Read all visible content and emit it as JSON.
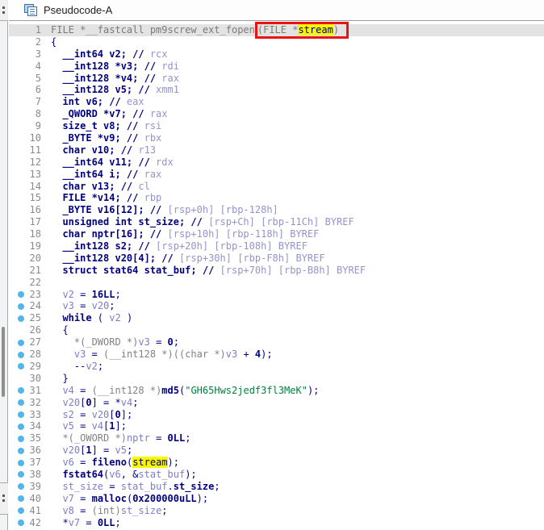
{
  "window": {
    "tab_label": "Pseudocode-A"
  },
  "annotation": {
    "box_color": "#ec1212",
    "highlight_color": "#f7f700",
    "highlighted_identifier": "stream"
  },
  "code": {
    "lines": [
      {
        "n": 1,
        "hl": true,
        "s": [
          [
            "g",
            "FILE *__fastcall pm9screw_ext_fopen"
          ]
        ],
        "box": [
          [
            "g",
            "(FILE *"
          ],
          [
            "y",
            "stream"
          ],
          [
            "g",
            ")"
          ]
        ]
      },
      {
        "n": 2,
        "s": [
          [
            "p",
            "{"
          ]
        ]
      },
      {
        "n": 3,
        "s": [
          [
            "k",
            "  __int64 v2; // "
          ],
          [
            "r",
            "rcx"
          ]
        ]
      },
      {
        "n": 4,
        "s": [
          [
            "k",
            "  __int128 *v3; // "
          ],
          [
            "r",
            "rdi"
          ]
        ]
      },
      {
        "n": 5,
        "s": [
          [
            "k",
            "  __int128 *v4; // "
          ],
          [
            "r",
            "rax"
          ]
        ]
      },
      {
        "n": 6,
        "s": [
          [
            "k",
            "  __int128 v5; // "
          ],
          [
            "r",
            "xmm1"
          ]
        ]
      },
      {
        "n": 7,
        "s": [
          [
            "k",
            "  int v6; // "
          ],
          [
            "r",
            "eax"
          ]
        ]
      },
      {
        "n": 8,
        "s": [
          [
            "k",
            "  _QWORD *v7; // "
          ],
          [
            "r",
            "rax"
          ]
        ]
      },
      {
        "n": 9,
        "s": [
          [
            "k",
            "  size_t v8; // "
          ],
          [
            "r",
            "rsi"
          ]
        ]
      },
      {
        "n": 10,
        "s": [
          [
            "k",
            "  _BYTE *v9; // "
          ],
          [
            "r",
            "rbx"
          ]
        ]
      },
      {
        "n": 11,
        "s": [
          [
            "k",
            "  char v10; // "
          ],
          [
            "r",
            "r13"
          ]
        ]
      },
      {
        "n": 12,
        "s": [
          [
            "k",
            "  __int64 v11; // "
          ],
          [
            "r",
            "rdx"
          ]
        ]
      },
      {
        "n": 13,
        "s": [
          [
            "k",
            "  __int64 i; // "
          ],
          [
            "r",
            "rax"
          ]
        ]
      },
      {
        "n": 14,
        "s": [
          [
            "k",
            "  char v13; // "
          ],
          [
            "r",
            "cl"
          ]
        ]
      },
      {
        "n": 15,
        "s": [
          [
            "k",
            "  FILE *v14; // "
          ],
          [
            "r",
            "rbp"
          ]
        ]
      },
      {
        "n": 16,
        "s": [
          [
            "k",
            "  _BYTE v16[12]; // "
          ],
          [
            "r",
            "[rsp+0h] [rbp-128h]"
          ]
        ]
      },
      {
        "n": 17,
        "s": [
          [
            "k",
            "  unsigned int st_size; // "
          ],
          [
            "r",
            "[rsp+Ch] [rbp-11Ch] BYREF"
          ]
        ]
      },
      {
        "n": 18,
        "s": [
          [
            "k",
            "  char nptr[16]; // "
          ],
          [
            "r",
            "[rsp+10h] [rbp-118h] BYREF"
          ]
        ]
      },
      {
        "n": 19,
        "s": [
          [
            "k",
            "  __int128 s2; // "
          ],
          [
            "r",
            "[rsp+20h] [rbp-108h] BYREF"
          ]
        ]
      },
      {
        "n": 20,
        "s": [
          [
            "k",
            "  __int128 v20[4]; // "
          ],
          [
            "r",
            "[rsp+30h] [rbp-F8h] BYREF"
          ]
        ]
      },
      {
        "n": 21,
        "s": [
          [
            "k",
            "  struct stat64 stat_buf; // "
          ],
          [
            "r",
            "[rsp+70h] [rbp-B8h] BYREF"
          ]
        ]
      },
      {
        "n": 22,
        "s": []
      },
      {
        "n": 23,
        "d": true,
        "s": [
          [
            "p",
            "  "
          ],
          [
            "v",
            "v2"
          ],
          [
            "p",
            " = "
          ],
          [
            "n",
            "16LL"
          ],
          [
            "p",
            ";"
          ]
        ]
      },
      {
        "n": 24,
        "d": true,
        "s": [
          [
            "p",
            "  "
          ],
          [
            "v",
            "v3"
          ],
          [
            "p",
            " = "
          ],
          [
            "v",
            "v20"
          ],
          [
            "p",
            ";"
          ]
        ]
      },
      {
        "n": 25,
        "d": true,
        "s": [
          [
            "k",
            "  while"
          ],
          [
            "p",
            " ( "
          ],
          [
            "v",
            "v2"
          ],
          [
            "p",
            " )"
          ]
        ]
      },
      {
        "n": 26,
        "s": [
          [
            "p",
            "  {"
          ]
        ]
      },
      {
        "n": 27,
        "d": true,
        "s": [
          [
            "p",
            "    "
          ],
          [
            "c",
            "*(_DWORD *)"
          ],
          [
            "v",
            "v3"
          ],
          [
            "p",
            " = "
          ],
          [
            "n",
            "0"
          ],
          [
            "p",
            ";"
          ]
        ]
      },
      {
        "n": 28,
        "d": true,
        "s": [
          [
            "p",
            "    "
          ],
          [
            "v",
            "v3"
          ],
          [
            "p",
            " = "
          ],
          [
            "c",
            "(__int128 *)((char *)"
          ],
          [
            "v",
            "v3"
          ],
          [
            "p",
            " + "
          ],
          [
            "n",
            "4"
          ],
          [
            "p",
            ");"
          ]
        ]
      },
      {
        "n": 29,
        "d": true,
        "s": [
          [
            "p",
            "    --"
          ],
          [
            "v",
            "v2"
          ],
          [
            "p",
            ";"
          ]
        ]
      },
      {
        "n": 30,
        "s": [
          [
            "p",
            "  }"
          ]
        ]
      },
      {
        "n": 31,
        "d": true,
        "s": [
          [
            "p",
            "  "
          ],
          [
            "v",
            "v4"
          ],
          [
            "p",
            " = "
          ],
          [
            "c",
            "(__int128 *)"
          ],
          [
            "k",
            "md5"
          ],
          [
            "p",
            "("
          ],
          [
            "s",
            "\"GH65Hws2jedf3fl3MeK\""
          ],
          [
            "p",
            ");"
          ]
        ]
      },
      {
        "n": 32,
        "d": true,
        "s": [
          [
            "p",
            "  "
          ],
          [
            "v",
            "v20"
          ],
          [
            "p",
            "["
          ],
          [
            "n",
            "0"
          ],
          [
            "p",
            "] = *"
          ],
          [
            "v",
            "v4"
          ],
          [
            "p",
            ";"
          ]
        ]
      },
      {
        "n": 33,
        "d": true,
        "s": [
          [
            "p",
            "  "
          ],
          [
            "v",
            "s2"
          ],
          [
            "p",
            " = "
          ],
          [
            "v",
            "v20"
          ],
          [
            "p",
            "["
          ],
          [
            "n",
            "0"
          ],
          [
            "p",
            "];"
          ]
        ]
      },
      {
        "n": 34,
        "d": true,
        "s": [
          [
            "p",
            "  "
          ],
          [
            "v",
            "v5"
          ],
          [
            "p",
            " = "
          ],
          [
            "v",
            "v4"
          ],
          [
            "p",
            "["
          ],
          [
            "n",
            "1"
          ],
          [
            "p",
            "];"
          ]
        ]
      },
      {
        "n": 35,
        "d": true,
        "s": [
          [
            "p",
            "  "
          ],
          [
            "c",
            "*(_OWORD *)"
          ],
          [
            "v",
            "nptr"
          ],
          [
            "p",
            " = "
          ],
          [
            "n",
            "0LL"
          ],
          [
            "p",
            ";"
          ]
        ]
      },
      {
        "n": 36,
        "d": true,
        "s": [
          [
            "p",
            "  "
          ],
          [
            "v",
            "v20"
          ],
          [
            "p",
            "["
          ],
          [
            "n",
            "1"
          ],
          [
            "p",
            "] = "
          ],
          [
            "v",
            "v5"
          ],
          [
            "p",
            ";"
          ]
        ]
      },
      {
        "n": 37,
        "d": true,
        "s": [
          [
            "p",
            "  "
          ],
          [
            "v",
            "v6"
          ],
          [
            "p",
            " = "
          ],
          [
            "k",
            "fileno"
          ],
          [
            "p",
            "("
          ],
          [
            "y",
            "stream"
          ],
          [
            "p",
            ");"
          ]
        ]
      },
      {
        "n": 38,
        "d": true,
        "s": [
          [
            "p",
            "  "
          ],
          [
            "k",
            "fstat64"
          ],
          [
            "p",
            "("
          ],
          [
            "v",
            "v6"
          ],
          [
            "p",
            ", &"
          ],
          [
            "v",
            "stat_buf"
          ],
          [
            "p",
            ");"
          ]
        ]
      },
      {
        "n": 39,
        "d": true,
        "s": [
          [
            "p",
            "  "
          ],
          [
            "v",
            "st_size"
          ],
          [
            "p",
            " = "
          ],
          [
            "v",
            "stat_buf"
          ],
          [
            "p",
            "."
          ],
          [
            "k",
            "st_size"
          ],
          [
            "p",
            ";"
          ]
        ]
      },
      {
        "n": 40,
        "d": true,
        "s": [
          [
            "p",
            "  "
          ],
          [
            "v",
            "v7"
          ],
          [
            "p",
            " = "
          ],
          [
            "k",
            "malloc"
          ],
          [
            "p",
            "("
          ],
          [
            "n",
            "0x200000uLL"
          ],
          [
            "p",
            ");"
          ]
        ]
      },
      {
        "n": 41,
        "d": true,
        "s": [
          [
            "p",
            "  "
          ],
          [
            "v",
            "v8"
          ],
          [
            "p",
            " = "
          ],
          [
            "c",
            "(int)"
          ],
          [
            "v",
            "st_size"
          ],
          [
            "p",
            ";"
          ]
        ]
      },
      {
        "n": 42,
        "d": true,
        "s": [
          [
            "p",
            "  *"
          ],
          [
            "v",
            "v7"
          ],
          [
            "p",
            " = "
          ],
          [
            "n",
            "0LL"
          ],
          [
            "p",
            ";"
          ]
        ]
      }
    ]
  }
}
